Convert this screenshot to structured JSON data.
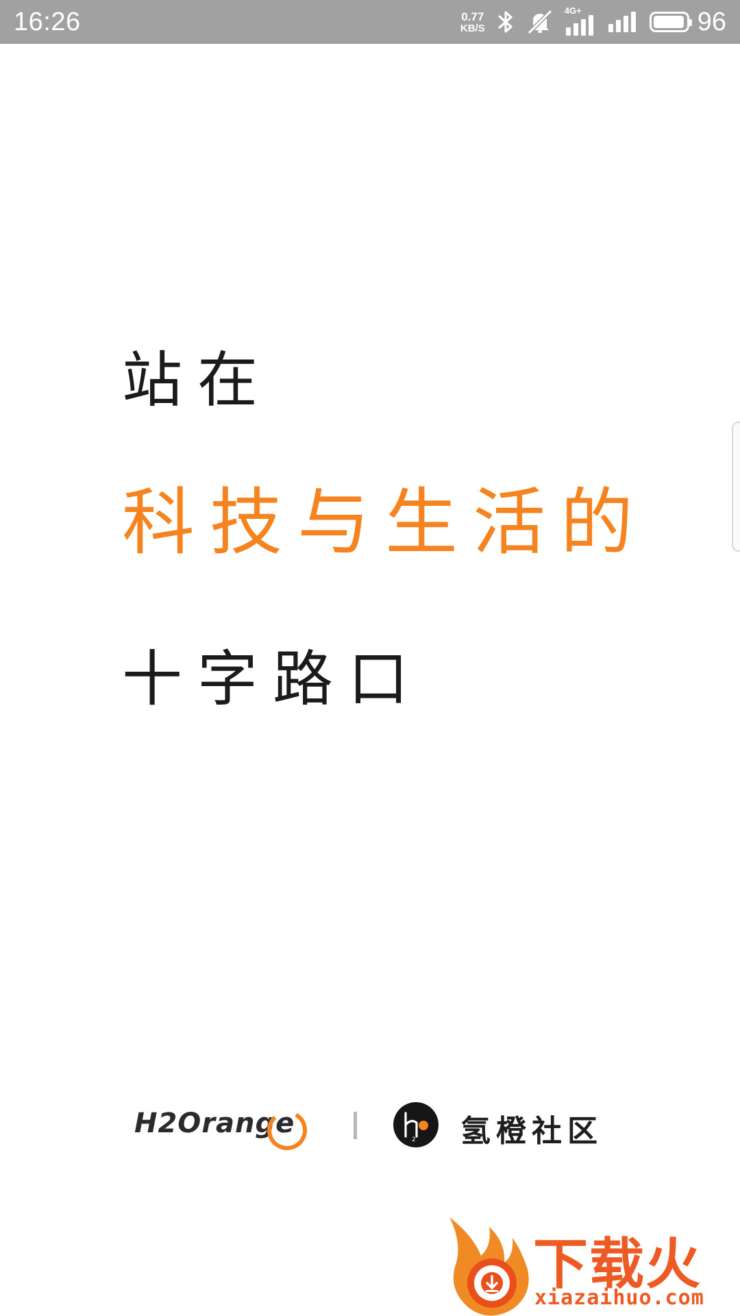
{
  "status_bar": {
    "time": "16:26",
    "net_speed_value": "0.77",
    "net_speed_unit": "KB/S",
    "network_type": "4G+",
    "battery_percent": "96",
    "battery_level": 0.96,
    "icons": [
      "bluetooth-icon",
      "silent-mode-icon",
      "signal-4g-icon",
      "signal-icon",
      "battery-icon"
    ]
  },
  "slogan": {
    "line1": "站在",
    "line2": "科技与生活的",
    "line3": "十字路口",
    "accent_color": "#f5831f",
    "text_color": "#1b1b1b"
  },
  "brand": {
    "logo_text": "H2Orange",
    "community_name": "氢橙社区",
    "accent_color": "#f5831f"
  },
  "watermark": {
    "title": "下载火",
    "url": "xiazaihuo.com",
    "color": "#ee5a24"
  }
}
